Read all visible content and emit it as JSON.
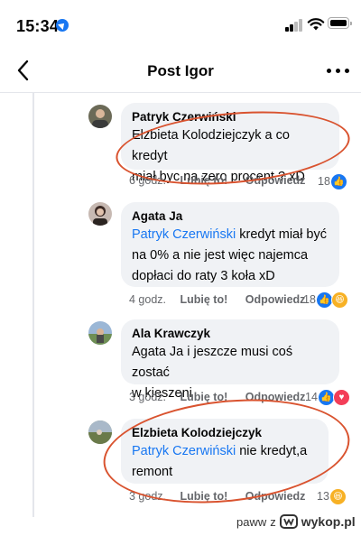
{
  "status_bar": {
    "time": "15:34"
  },
  "nav": {
    "title": "Post Igor"
  },
  "comments": [
    {
      "author": "Patryk Czerwiński",
      "mention": "",
      "text": "Elzbieta Kolodziejczyk a co kredyt miał.byc na zero procent ? xD",
      "line1": "Elzbieta Kolodziejczyk a co kredyt",
      "line2": "miał.byc na zero procent ? xD",
      "time": "6 godz.",
      "like": "Lubię to!",
      "reply": "Odpowiedz",
      "reaction_count": "18",
      "reactions": [
        "like-reaction"
      ]
    },
    {
      "author": "Agata Ja",
      "mention": "Patryk Czerwiński",
      "line1_rest": " kredyt miał być",
      "line2": "na 0% a nie jest więc najemca",
      "line3": "dopłaci do raty 3 koła xD",
      "time": "4 godz.",
      "like": "Lubię to!",
      "reply": "Odpowiedz",
      "reaction_count": "18",
      "reactions": [
        "like-reaction",
        "haha-reaction"
      ]
    },
    {
      "author": "Ala Krawczyk",
      "line1": "Agata Ja i jeszcze musi coś zostać",
      "line2": "w kieszeni",
      "time": "3 godz.",
      "like": "Lubię to!",
      "reply": "Odpowiedz",
      "reaction_count": "14",
      "reactions": [
        "like-reaction",
        "love-reaction"
      ]
    },
    {
      "author": "Elzbieta Kolodziejczyk",
      "mention": "Patryk Czerwiński",
      "line1_rest": " nie kredyt,a",
      "line2": "remont",
      "time": "3 godz.",
      "like": "Lubię to!",
      "reply": "Odpowiedz",
      "reaction_count": "13",
      "reactions": [
        "haha-reaction"
      ]
    }
  ],
  "watermark": {
    "user": "paww",
    "sep": "z",
    "site": "wykop.pl"
  },
  "colors": {
    "accent": "#1877f2",
    "annotation": "#d9532f",
    "bubble": "#f0f2f5"
  }
}
